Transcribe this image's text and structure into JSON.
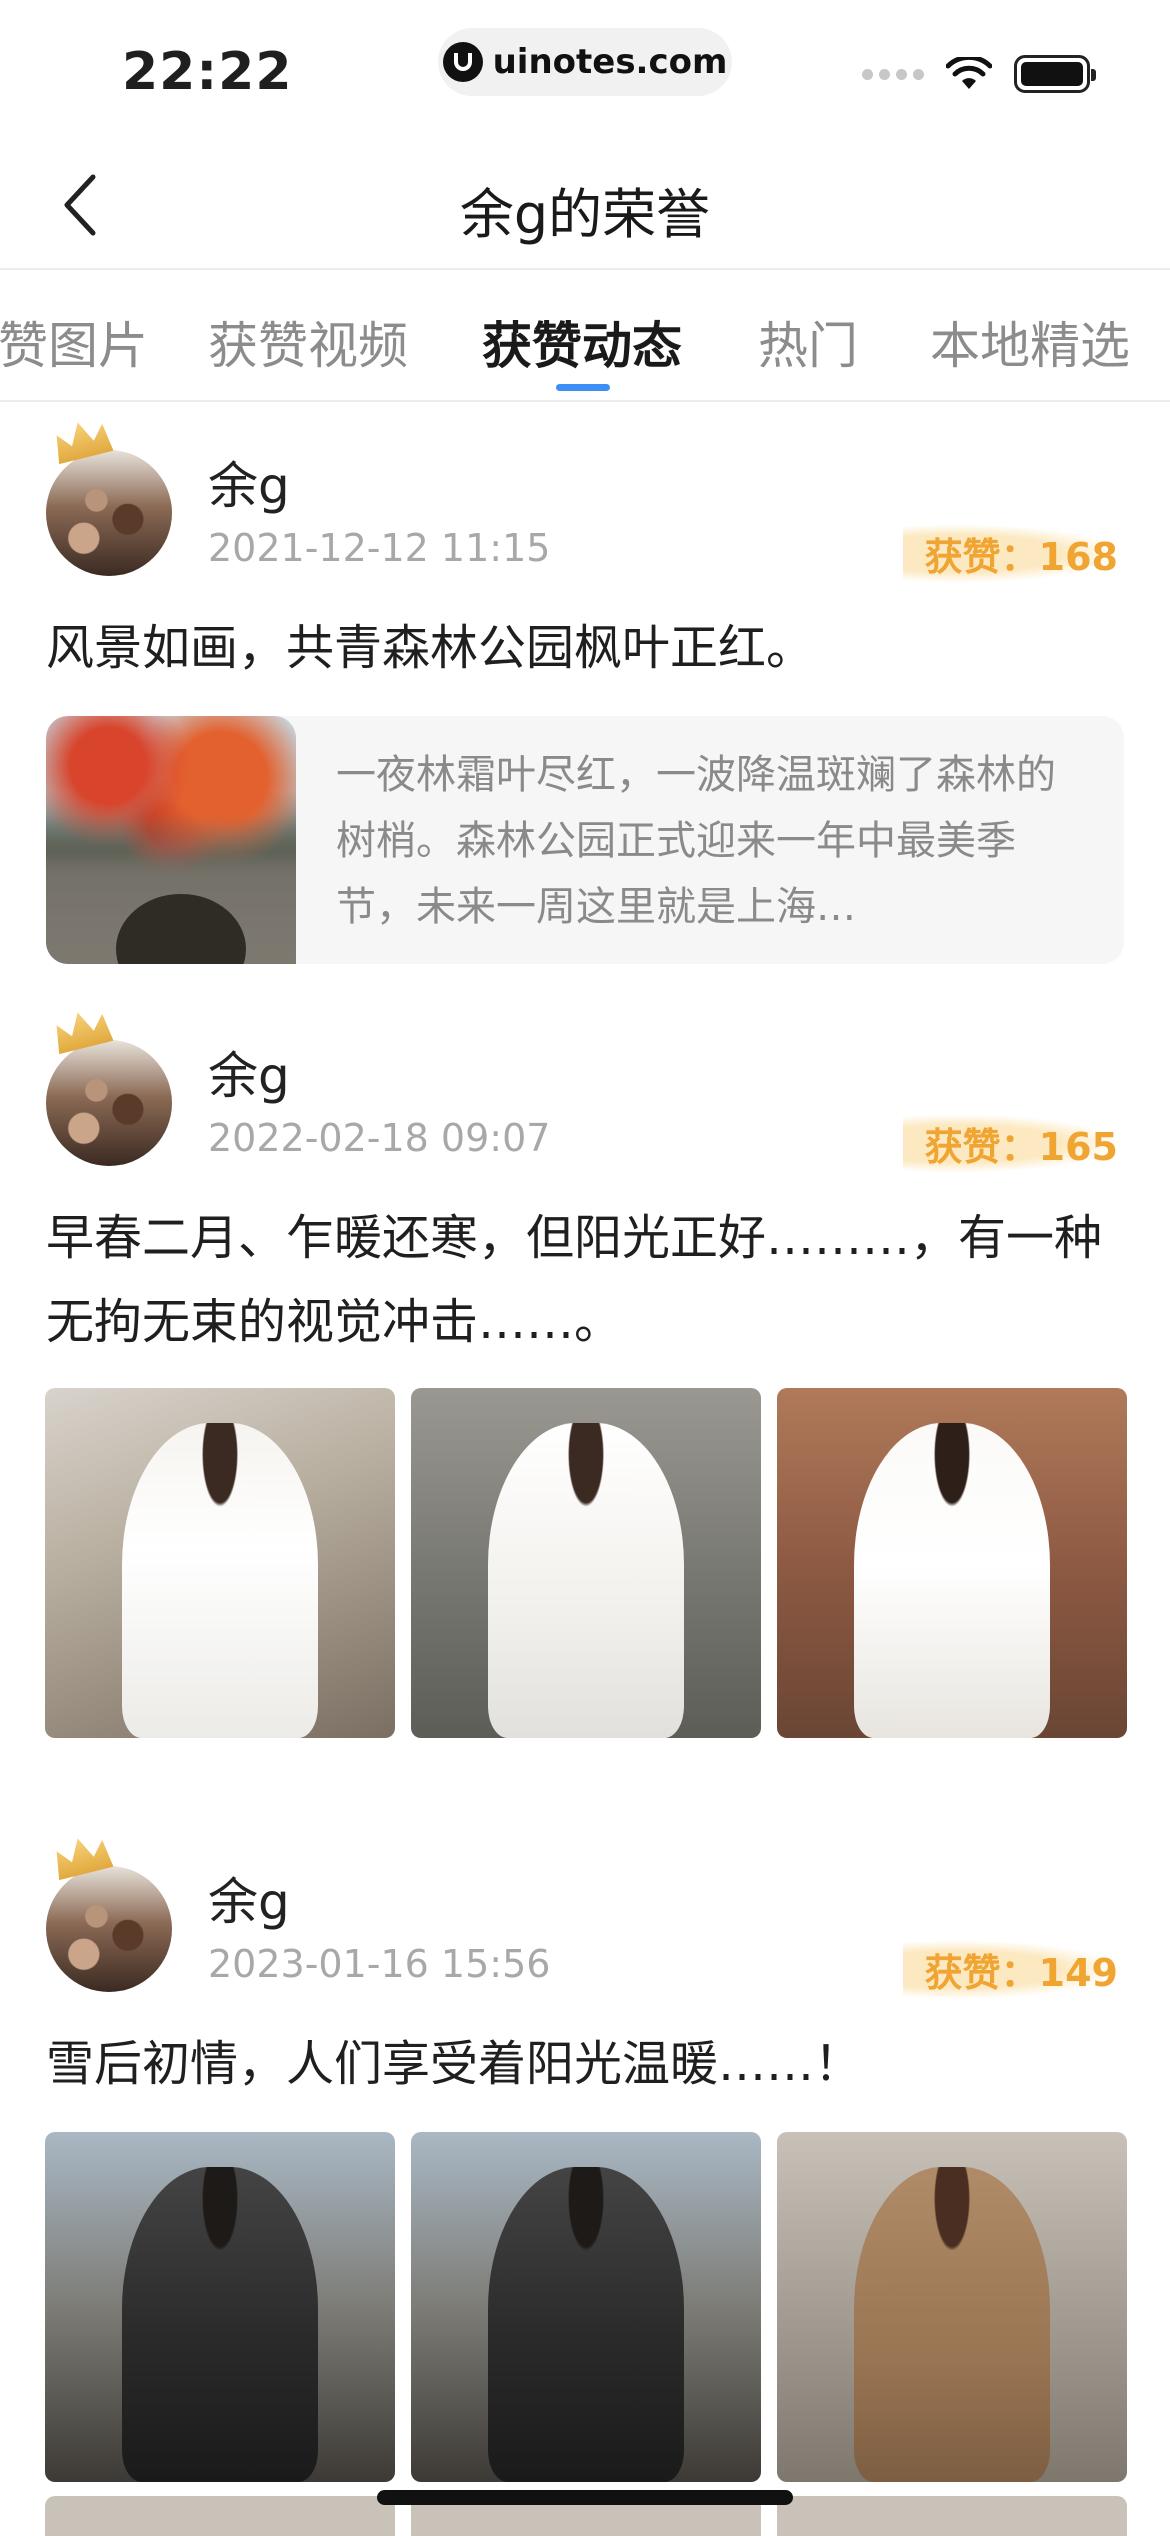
{
  "status_bar": {
    "time": "22:22",
    "url": "uinotes.com",
    "icons": [
      "signal-dots-icon",
      "wifi-icon",
      "battery-icon"
    ]
  },
  "nav": {
    "back_icon": "chevron-left-icon",
    "title": "余g的荣誉"
  },
  "tabs": [
    {
      "label": "获赞图片",
      "active": false
    },
    {
      "label": "获赞视频",
      "active": false
    },
    {
      "label": "获赞动态",
      "active": true
    },
    {
      "label": "热门",
      "active": false
    },
    {
      "label": "本地精选",
      "active": false
    }
  ],
  "colors": {
    "accent": "#3d8ff5",
    "likes": "#f0a431",
    "muted": "#a8a8a8"
  },
  "posts": [
    {
      "author": "余g",
      "time": "2021-12-12 11:15",
      "likes": "获赞：168",
      "text": "风景如画，共青森林公园枫叶正红。",
      "share": {
        "text": "一夜林霜叶尽红，一波降温斑斓了森林的树梢。森林公园正式迎来一年中最美季节，未来一周这里就是上海…"
      }
    },
    {
      "author": "余g",
      "time": "2022-02-18 09:07",
      "likes": "获赞：165",
      "text": "早春二月、乍暖还寒，但阳光正好………，有一种无拘无束的视觉冲击……。",
      "images": [
        "photo-white-coat-brick",
        "photo-white-coat-stairs",
        "photo-white-coat-pose"
      ]
    },
    {
      "author": "余g",
      "time": "2023-01-16 15:56",
      "likes": "获赞：149",
      "text": "雪后初情，人们享受着阳光温暖……！",
      "images": [
        "photo-grey-cardigan-street",
        "photo-grey-cardigan-bag",
        "photo-camel-coat"
      ]
    }
  ]
}
